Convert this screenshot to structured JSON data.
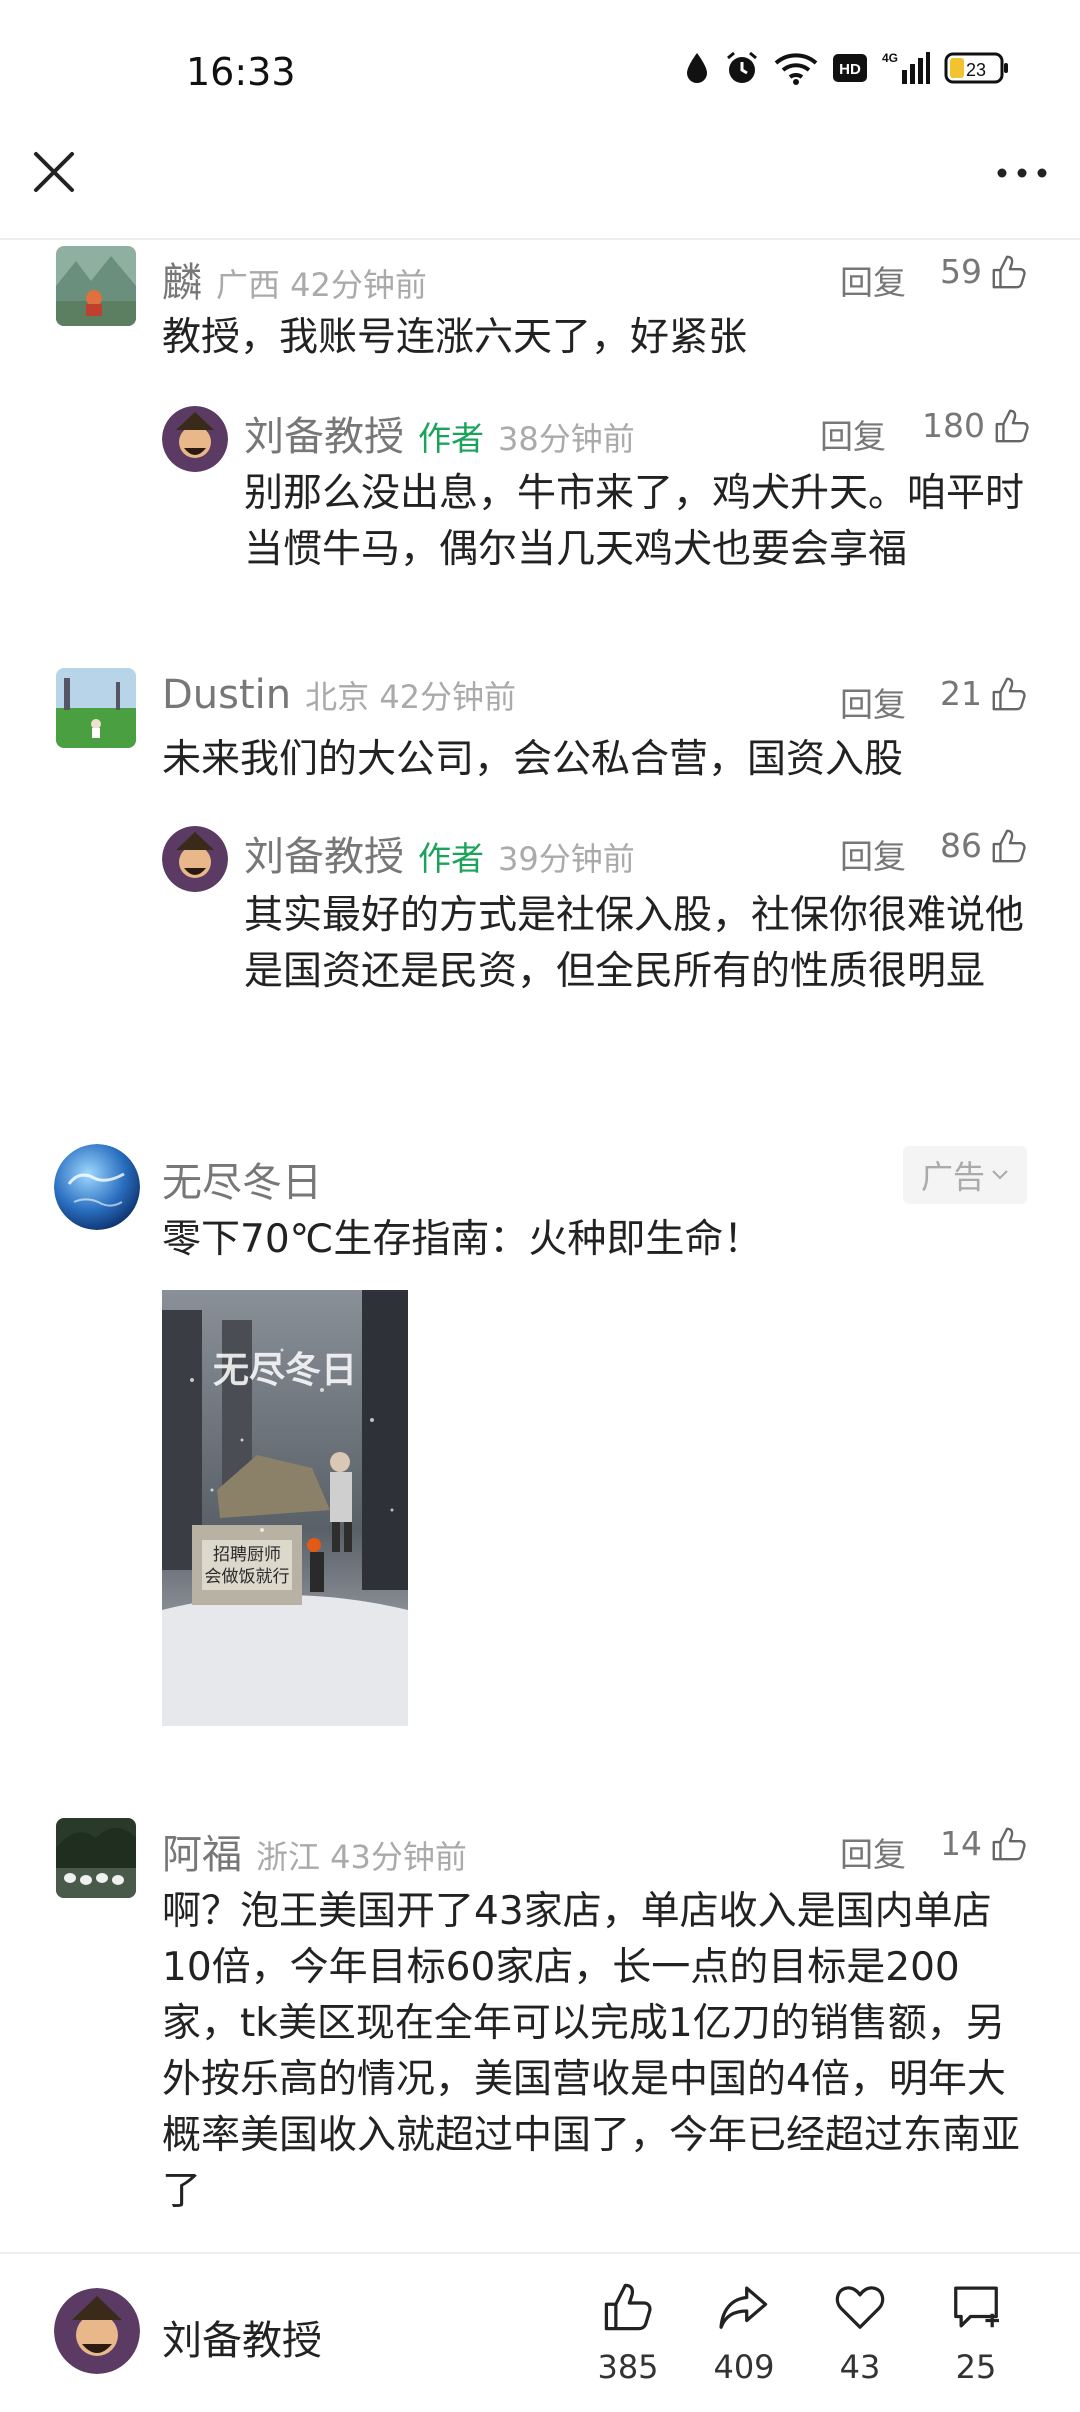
{
  "status": {
    "time": "16:33",
    "battery": "23"
  },
  "comments": [
    {
      "name": "麟",
      "location": "广西 42分钟前",
      "reply": "回复",
      "likes": "59",
      "text": "教授，我账号连涨六天了，好紧张",
      "reply_item": {
        "name": "刘备教授",
        "tag": "作者",
        "time": "38分钟前",
        "reply": "回复",
        "likes": "180",
        "text": "别那么没出息，牛市来了，鸡犬升天。咱平时当惯牛马，偶尔当几天鸡犬也要会享福"
      }
    },
    {
      "name": "Dustin",
      "location": "北京 42分钟前",
      "reply": "回复",
      "likes": "21",
      "text": "未来我们的大公司，会公私合营，国资入股",
      "reply_item": {
        "name": "刘备教授",
        "tag": "作者",
        "time": "39分钟前",
        "reply": "回复",
        "likes": "86",
        "text": "其实最好的方式是社保入股，社保你很难说他是国资还是民资，但全民所有的性质很明显"
      }
    },
    {
      "name": "阿福",
      "location": "浙江 43分钟前",
      "reply": "回复",
      "likes": "14",
      "text": "啊？泡王美国开了43家店，单店收入是国内单店10倍，今年目标60家店，长一点的目标是200家，tk美区现在全年可以完成1亿刀的销售额，另外按乐高的情况，美国营收是中国的4倍，明年大概率美国收入就超过中国了，今年已经超过东南亚了"
    }
  ],
  "ad": {
    "name": "无尽冬日",
    "badge": "广告",
    "text": "零下70℃生存指南：火种即生命！",
    "image_title": "无尽冬日",
    "image_sign_line1": "招聘厨师",
    "image_sign_line2": "会做饭就行"
  },
  "bottom": {
    "author": "刘备教授",
    "likes": "385",
    "shares": "409",
    "favorites": "43",
    "comments": "25"
  }
}
